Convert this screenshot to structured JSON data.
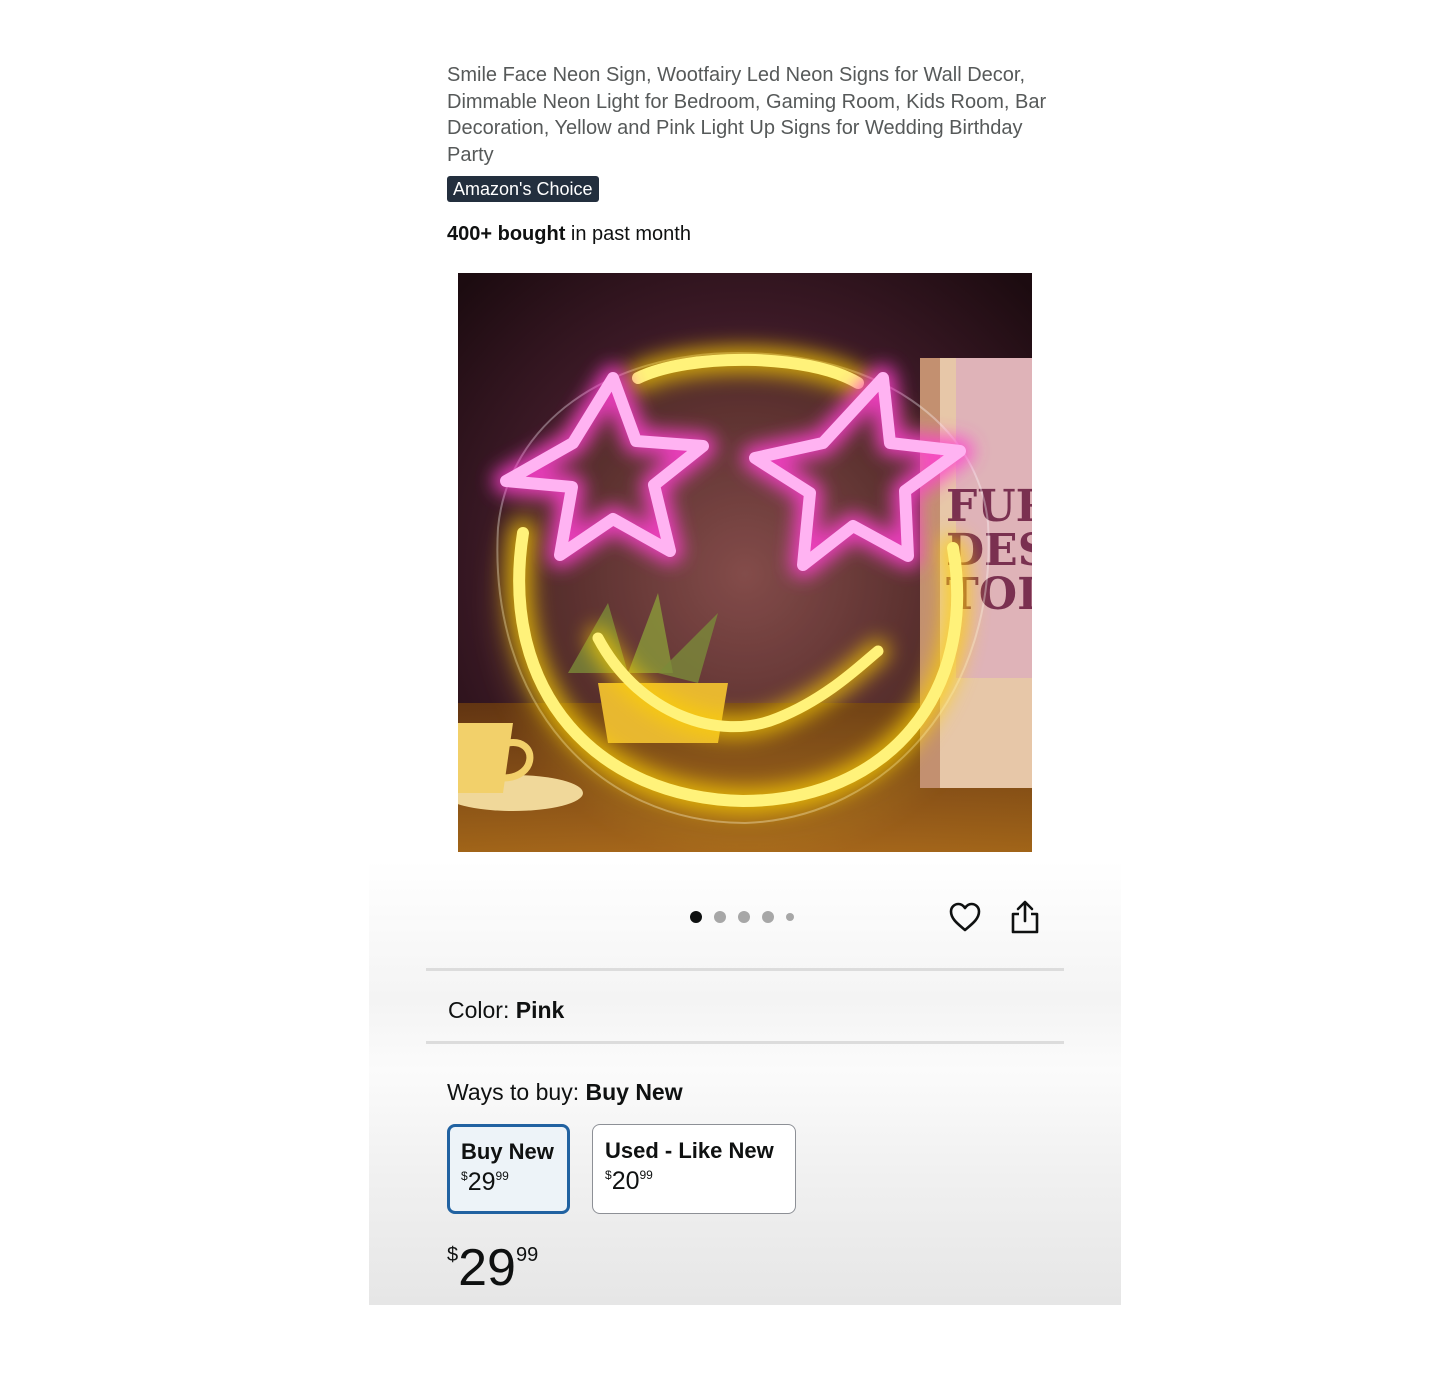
{
  "product": {
    "title": "Smile Face Neon Sign, Wootfairy Led Neon Signs for Wall Decor, Dimmable Neon Light for Bedroom, Gaming Room, Kids Room, Bar Decoration, Yellow and Pink Light Up Signs for Wedding Birthday Party",
    "badge": "Amazon's Choice",
    "bought_count": "400+ bought",
    "bought_suffix": " in past month"
  },
  "gallery": {
    "image_count": 5,
    "active_index": 0,
    "book_spine_text": [
      "FURI",
      "DESI",
      "TODA"
    ]
  },
  "actions": {
    "icons": [
      "heart-icon",
      "share-icon"
    ]
  },
  "color": {
    "label": "Color:",
    "value": "Pink"
  },
  "ways_to_buy": {
    "label": "Ways to buy:",
    "value": "Buy New",
    "options": [
      {
        "label": "Buy New",
        "currency": "$",
        "whole": "29",
        "fraction": "99",
        "selected": true
      },
      {
        "label": "Used - Like New",
        "currency": "$",
        "whole": "20",
        "fraction": "99",
        "selected": false
      }
    ]
  },
  "price": {
    "currency": "$",
    "whole": "29",
    "fraction": "99"
  },
  "colors": {
    "badge_bg": "#232f3e",
    "selected_border": "#2162a1",
    "neon_pink": "#ff7ae6",
    "neon_yellow": "#ffe640"
  }
}
